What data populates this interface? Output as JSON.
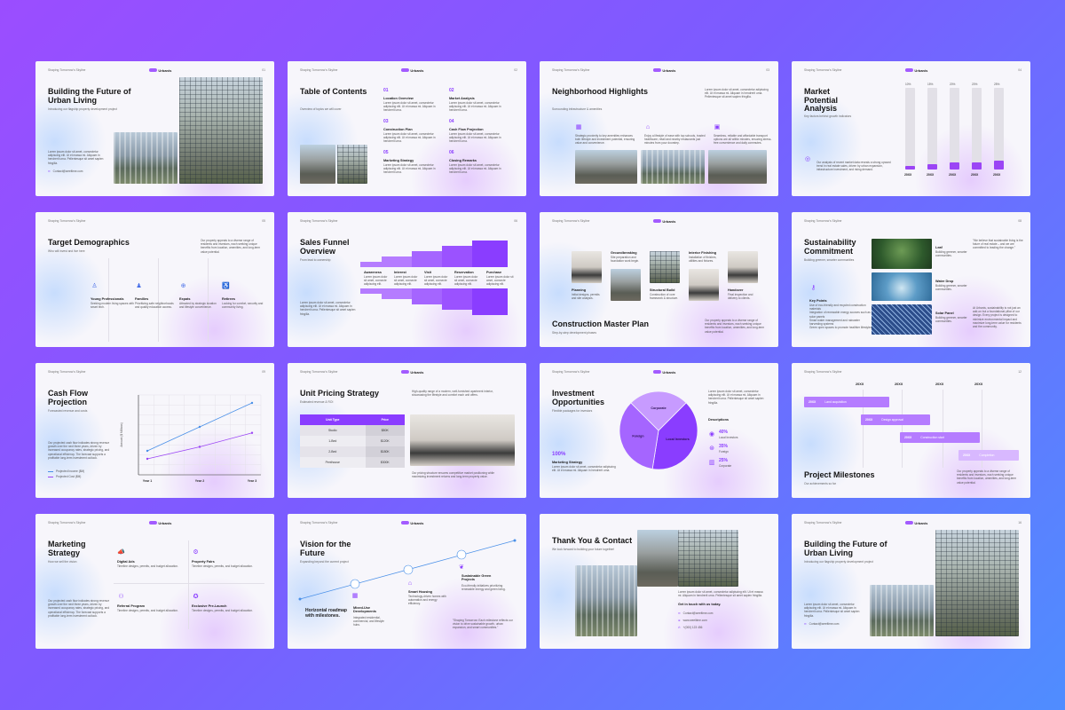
{
  "common": {
    "tagline": "Shaping Tomorrow's Skyline",
    "brand": "Urbanis"
  },
  "slides": [
    {
      "page": "01",
      "title": "Building the Future of Urban Living",
      "subtitle": "Introducing our flagship property development project",
      "body": "Lorem ipsum dolor sit amet, consectetur adipiscing elit. Ut et massa mi. Aliquam in hendrerit urna. Pellentesque sit amet sapien fringilla.",
      "contact": "Contact@weeltime.com"
    },
    {
      "page": "02",
      "title": "Table of Contents",
      "subtitle": "Overview of topics we will cover",
      "items": [
        {
          "num": "01",
          "label": "Location Overview"
        },
        {
          "num": "02",
          "label": "Market Analysis"
        },
        {
          "num": "03",
          "label": "Construction Plan"
        },
        {
          "num": "04",
          "label": "Cash Flow Projection"
        },
        {
          "num": "05",
          "label": "Marketing Strategy"
        },
        {
          "num": "06",
          "label": "Closing Remarks"
        }
      ],
      "item_body": "Lorem ipsum dolor sit amet, consectetur adipiscing elit. Ut et massa mi. Aliquam in hendrerit urna."
    },
    {
      "page": "03",
      "title": "Neighborhood Highlights",
      "subtitle": "Surrounding infrastructure & amenities",
      "body": "Lorem ipsum dolor sit amet, consectetur adipiscing elit. Ut et massa mi. Aliquam in hendrerit urna. Pellentesque sit amet sapien fringilla.",
      "columns": [
        "Strategic proximity to key amenities enhances both lifestyle and investment potential, ensuring value and convenience.",
        "Enjoy a lifestyle of ease with top schools, trusted healthcare, retail and nearby restaurants just minutes from your doorstep.",
        "Seamless, reliable and affordable transport options are all within minutes, ensuring stress-free convenience and daily commutes."
      ]
    },
    {
      "page": "04",
      "title": "Market Potential Analysis",
      "subtitle": "Key factors behind growth indicators",
      "body": "Our analysis of recent market data reveals a strong upward trend in real estate sales, driven by urban expansion, infrastructure investment, and rising demand.",
      "bars": [
        {
          "year": "20XX",
          "pct": "10%",
          "value": 0.1
        },
        {
          "year": "20XX",
          "pct": "15%",
          "value": 0.15
        },
        {
          "year": "20XX",
          "pct": "20%",
          "value": 0.2
        },
        {
          "year": "20XX",
          "pct": "20%",
          "value": 0.2
        },
        {
          "year": "20XX",
          "pct": "25%",
          "value": 0.25
        }
      ]
    },
    {
      "page": "05",
      "title": "Target Demographics",
      "subtitle": "Who will invest and live here",
      "body": "Our property appeals to a diverse range of residents and investors, each seeking unique benefits from location, amenities, and long-term value potential.",
      "segments": [
        {
          "label": "Young Professionals",
          "text": "Seeking modern living spaces with smart tech."
        },
        {
          "label": "Families",
          "text": "Prioritizing safe neighborhoods and quality education access."
        },
        {
          "label": "Expats",
          "text": "Attracted by strategic location and lifestyle convenience."
        },
        {
          "label": "Retirees",
          "text": "Looking for comfort, security and community living."
        }
      ]
    },
    {
      "page": "06",
      "title": "Sales Funnel Overview",
      "subtitle": "From lead to ownership",
      "body": "Lorem ipsum dolor sit amet, consectetur adipiscing elit. Ut et massa mi. Aliquam in hendrerit urna. Pellentesque sit amet sapien fringilla.",
      "stages": [
        {
          "label": "Awareness",
          "text": "Lorem ipsum dolor sit amet, consecte adipiscing elit."
        },
        {
          "label": "Interest",
          "text": "Lorem ipsum dolor sit amet, consecte adipiscing elit."
        },
        {
          "label": "Visit",
          "text": "Lorem ipsum dolor sit amet, consecte adipiscing elit."
        },
        {
          "label": "Reservation",
          "text": "Lorem ipsum dolor sit amet, consecte adipiscing elit."
        },
        {
          "label": "Purchase",
          "text": "Lorem ipsum dolor sit amet, consecte adipiscing elit."
        }
      ]
    },
    {
      "page": "07",
      "title": "Construction Master Plan",
      "subtitle": "Step-by-step development phases",
      "body": "Our property appeals to a diverse range of residents and investors, each seeking unique benefits from location, amenities, and long-term value potential.",
      "phases": [
        {
          "label": "Planning",
          "text": "Initial designs, permits and site analysis."
        },
        {
          "label": "Groundbreaking",
          "text": "Site preparation and foundation work begin."
        },
        {
          "label": "Structural Build",
          "text": "Construction of core framework & structure."
        },
        {
          "label": "Interior Finishing",
          "text": "Installation of finishes, utilities and fixtures."
        },
        {
          "label": "Handover",
          "text": "Final inspection and delivery to clients."
        }
      ]
    },
    {
      "page": "08",
      "title": "Sustainability Commitment",
      "subtitle": "Building greener, smarter communities",
      "quote": "\"We believe that sustainable living is the future of real estate – and we are committed to leading the change.\"",
      "body": "At Urbanis, sustainability is not just an add-on but a foundational pillar of our design. Every project is designed to minimize environmental impact and maximize long-term value for residents and the community.",
      "key_title": "Key Points",
      "key_points": [
        "Use of eco-friendly and recycled construction materials",
        "Integration of renewable energy sources such as solar panels",
        "Smart water management and rainwater harvesting systems",
        "Green open spaces to promote healthier lifestyles"
      ],
      "features": [
        {
          "label": "Leaf",
          "text": "Building greener, smarter communities."
        },
        {
          "label": "Water Drop",
          "text": "Building greener, smarter communities."
        },
        {
          "label": "Solar Panel",
          "text": "Building greener, smarter communities."
        }
      ]
    },
    {
      "page": "09",
      "title": "Cash Flow Projection",
      "subtitle": "Forecasted revenue and costs",
      "body": "Our projected cash flow indicates strong revenue growth over the next three years, driven by increased occupancy rates, strategic pricing, and operational efficiency. The forecast supports a profitable long-term investment outlook.",
      "chart_data": {
        "type": "line",
        "categories": [
          "Year 1",
          "Year 2",
          "Year 3"
        ],
        "ylabel": "Amount ($ Millions)",
        "series": [
          {
            "name": "Projected Income ($M)",
            "values": [
              1.2,
              2.4,
              3.6
            ]
          },
          {
            "name": "Projected Cost ($M)",
            "values": [
              0.8,
              1.4,
              2.1
            ]
          }
        ],
        "ylim": [
          0,
          4
        ],
        "grid": true,
        "legend": "bottom-left"
      }
    },
    {
      "page": "10",
      "title": "Unit Pricing Strategy",
      "subtitle": "Estimated revenue & ROI",
      "body_top": "High-quality range of a modern, well-furnished apartment interior, showcasing the lifestyle and comfort each unit offers.",
      "body_bottom": "Our pricing structure ensures competitive market positioning while maximizing investment returns and long-term property value.",
      "table": {
        "headers": [
          "Unit Type",
          "Price"
        ],
        "rows": [
          [
            "Studio",
            "$80K"
          ],
          [
            "1-Bed",
            "$120K"
          ],
          [
            "2-Bed",
            "$180K"
          ],
          [
            "Penthouse",
            "$300K"
          ]
        ]
      }
    },
    {
      "page": "11",
      "title": "Investment Opportunities",
      "subtitle": "Flexible packages for investors",
      "body_top": "Lorem ipsum dolor sit amet, consectetur adipiscing elit. Ut et massa mi. Aliquam in hendrerit urna. Pellentesque sit amet sapien fringilla.",
      "highlight_pct": "100%",
      "highlight_label": "Marketing Strategy",
      "highlight_body": "Lorem ipsum dolor sit amet, consectetur adipiscing elit. Ut et massa mi. Aliquam in hendrerit urna.",
      "descriptions_title": "Descriptions",
      "chart_data": {
        "type": "pie",
        "categories": [
          "Local Investors",
          "Foreign",
          "Corporate"
        ],
        "values": [
          40,
          35,
          25
        ]
      },
      "stats": [
        {
          "pct": "40%",
          "label": "Local Investors"
        },
        {
          "pct": "35%",
          "label": "Foreign"
        },
        {
          "pct": "25%",
          "label": "Corporate"
        }
      ]
    },
    {
      "page": "12",
      "title": "Project Milestones",
      "subtitle": "Our achievements so far",
      "body": "Our property appeals to a diverse range of residents and investors, each seeking unique benefits from location, amenities, and long-term value potential.",
      "years": [
        "20XX",
        "20XX",
        "20XX",
        "20XX"
      ],
      "milestones": [
        {
          "year": "20XX",
          "label": "Land acquisition"
        },
        {
          "year": "20XX",
          "label": "Design approval"
        },
        {
          "year": "20XX",
          "label": "Construction start"
        },
        {
          "year": "20XX",
          "label": "Completion"
        }
      ]
    },
    {
      "page": "13",
      "title": "Marketing Strategy",
      "subtitle": "How we sell the vision",
      "body": "Our projected cash flow indicates strong revenue growth over the next three years, driven by increased occupancy rates, strategic pricing, and operational efficiency. The forecast supports a profitable long-term investment outlook.",
      "channels": [
        {
          "label": "Digital Ads",
          "text": "Timeline designs, permits, and budget allocation."
        },
        {
          "label": "Property Fairs",
          "text": "Timeline designs, permits, and budget allocation."
        },
        {
          "label": "Referral Program",
          "text": "Timeline designs, permits, and budget allocation."
        },
        {
          "label": "Exclusive Pre-Launch",
          "text": "Timeline designs, permits, and budget allocation."
        }
      ]
    },
    {
      "page": "14",
      "title": "Vision for the Future",
      "subtitle": "Expanding beyond the current project",
      "roadmap_label": "Horizontal roadmap with milestones.",
      "body": "\"Shaping Tomorrow: Each milestone reflects our vision to drive sustainable growth, urban expansion, and smart communities.\"",
      "steps": [
        {
          "label": "Mixed-Use Developments",
          "text": "Integrated residential, commercial, and lifestyle hubs."
        },
        {
          "label": "Smart Housing",
          "text": "Technology-driven homes with automation and energy efficiency."
        },
        {
          "label": "Sustainable Green Projects",
          "text": "Eco-friendly initiatives prioritizing renewable energy and green living."
        }
      ]
    },
    {
      "page": "15",
      "title": "Thank You & Contact",
      "subtitle": "We look forward to building your future together!",
      "body": "Lorem ipsum dolor sit amet, consectetur adipiscing elit. Ut et massa mi. Aliquam in hendrerit urna. Pellentesque sit amet sapien fringilla.",
      "cta": "Get in touch with us today.",
      "contacts": [
        "Contact@weeltime.com",
        "www.weeltime.com",
        "+(000) 123 456"
      ]
    },
    {
      "page": "16",
      "title": "Building the Future of Urban Living",
      "subtitle": "Introducing our flagship property development project",
      "body": "Lorem ipsum dolor sit amet, consectetur adipiscing elit. Ut et massa mi. Aliquam in hendrerit urna. Pellentesque sit amet sapien fringilla.",
      "contact": "Contact@weeltime.com"
    }
  ]
}
